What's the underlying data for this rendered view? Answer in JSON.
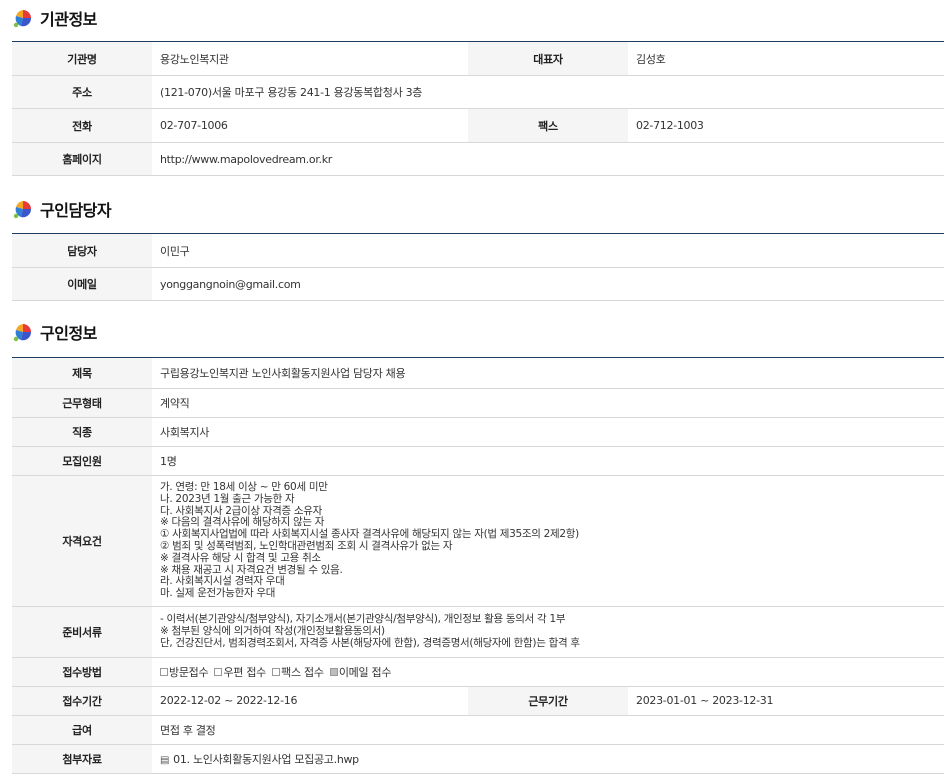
{
  "sections": {
    "agency": {
      "title": "기관정보",
      "rows": {
        "name_label": "기관명",
        "name_value": "용강노인복지관",
        "rep_label": "대표자",
        "rep_value": "김성호",
        "addr_label": "주소",
        "addr_value": "(121-070)서울 마포구 용강동 241-1 용강동복합청사 3층",
        "phone_label": "전화",
        "phone_value": "02-707-1006",
        "fax_label": "팩스",
        "fax_value": "02-712-1003",
        "homepage_label": "홈페이지",
        "homepage_value": "http://www.mapolovedream.or.kr"
      }
    },
    "contact": {
      "title": "구인담당자",
      "rows": {
        "manager_label": "담당자",
        "manager_value": "이민구",
        "email_label": "이메일",
        "email_value": "yonggangnoin@gmail.com"
      }
    },
    "job": {
      "title": "구인정보",
      "rows": {
        "subject_label": "제목",
        "subject_value": "구립용강노인복지관 노인사회활동지원사업 담당자 채용",
        "worktype_label": "근무형태",
        "worktype_value": "계약직",
        "occupation_label": "직종",
        "occupation_value": "사회복지사",
        "headcount_label": "모집인원",
        "headcount_value": "1명",
        "qual_label": "자격요건",
        "qual_value": "  가. 연령: 만 18세 이상 ~ 만 60세 미만\n  나. 2023년 1월 출근 가능한 자\n  다. 사회복지사 2급이상 자격증 소유자\n  ※ 다음의 결격사유에 해당하지 않는 자\n   ① 사회복지사업법에 따라 사회복지시설 종사자 결격사유에 해당되지 않는 자(법 제35조의 2제2항)\n   ② 범죄 및 성폭력범죄, 노인학대관련범죄 조회 시 결격사유가 없는 자\n  ※ 결격사유 해당 시 합격 및 고용 취소\n  ※ 채용 재공고 시 자격요건 변경될 수 있음.\n  라. 사회복지시설 경력자 우대\n  마. 실제 운전가능한자 우대",
        "docs_label": "준비서류",
        "docs_value": "- 이력서(본기관양식/첨부양식), 자기소개서(본기관양식/첨부양식), 개인정보 활용 동의서 각 1부\n     ※ 첨부된 양식에 의거하여 작성(개인정보활용동의서)\n     단, 건강진단서, 범죄경력조회서, 자격증 사본(해당자에 한함), 경력증명서(해당자에 한함)는 합격 후",
        "method_label": "접수방법",
        "methods": [
          "방문접수",
          "우편 접수",
          "팩스 접수",
          "이메일 접수"
        ],
        "method_checked": [
          false,
          false,
          false,
          true
        ],
        "period_label": "접수기간",
        "period_value": "2022-12-02 ~ 2022-12-16",
        "workperiod_label": "근무기간",
        "workperiod_value": "2023-01-01 ~ 2023-12-31",
        "pay_label": "급여",
        "pay_value": "면접 후 결정",
        "attach_label": "첨부자료",
        "attach_value": "01. 노인사회활동지원사업 모집공고.hwp"
      }
    }
  },
  "icons": {
    "section_logo": "colorful-leaf-logo",
    "attachment": "file-icon"
  },
  "colors": {
    "header_rule": "#1f3d5e",
    "label_bg": "#f5f5f5"
  }
}
